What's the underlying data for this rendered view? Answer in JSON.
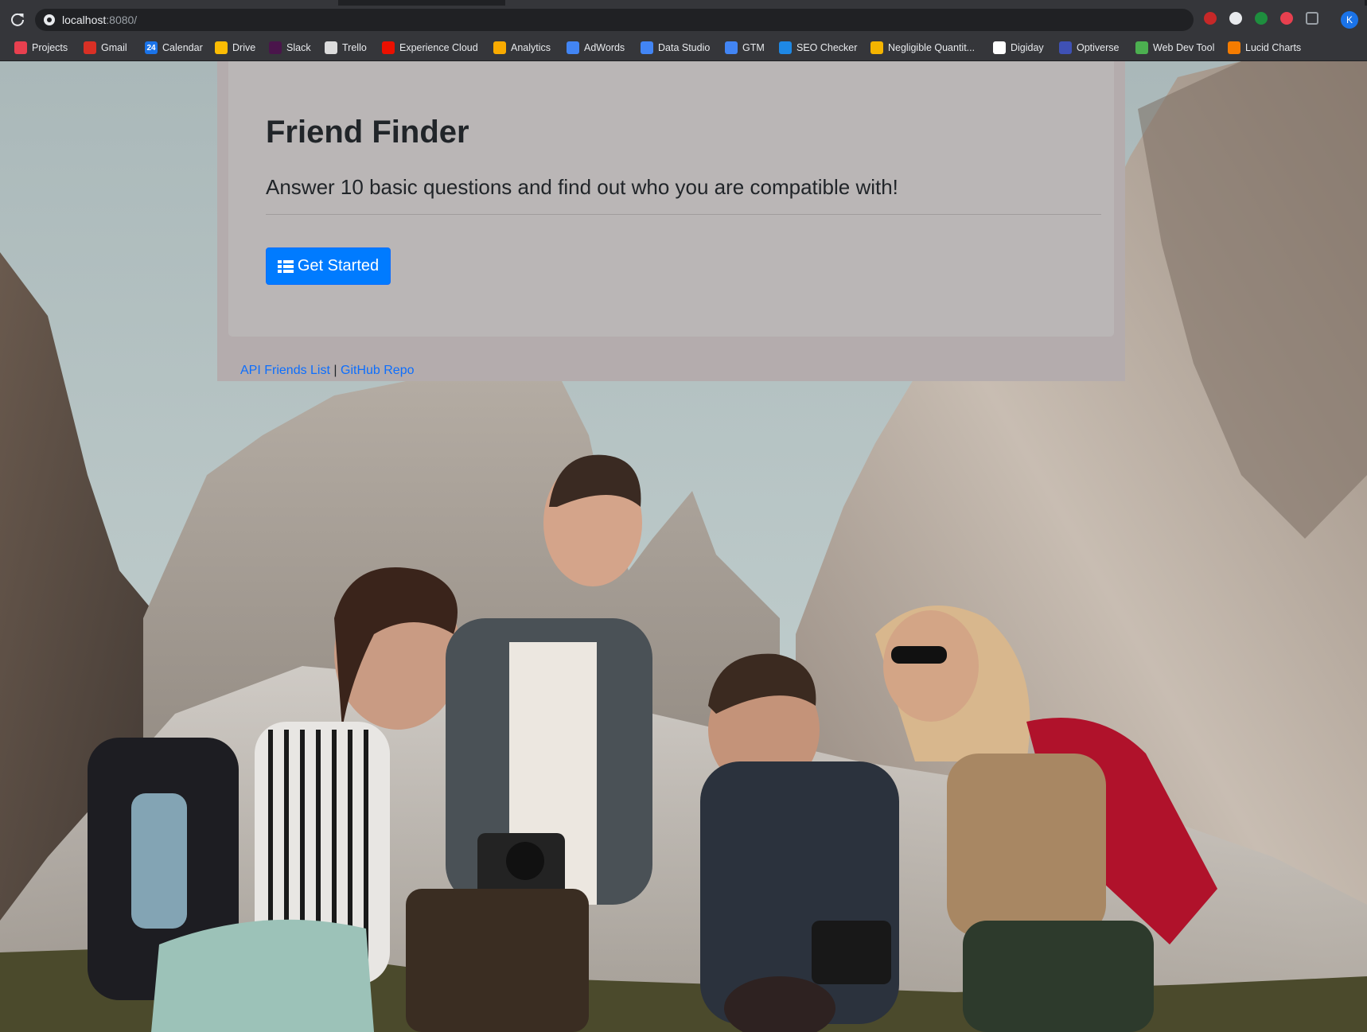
{
  "browser": {
    "url_host": "localhost",
    "url_port": ":8080/",
    "profile_initial": "K",
    "bookmarks": [
      {
        "label": "Projects",
        "icon": "projects-icon",
        "color": "#e8404f"
      },
      {
        "label": "Gmail",
        "icon": "gmail-icon",
        "color": "#d93025"
      },
      {
        "label": "Calendar",
        "icon": "calendar-icon",
        "color": "#1a73e8",
        "glyph": "24"
      },
      {
        "label": "Drive",
        "icon": "drive-icon",
        "color": "#fbbc04"
      },
      {
        "label": "Slack",
        "icon": "slack-icon",
        "color": "#4a154b"
      },
      {
        "label": "Trello",
        "icon": "trello-icon",
        "color": "#dcdcdc"
      },
      {
        "label": "Experience Cloud",
        "icon": "adobe-icon",
        "color": "#eb1000"
      },
      {
        "label": "Analytics",
        "icon": "analytics-icon",
        "color": "#f9ab00"
      },
      {
        "label": "AdWords",
        "icon": "adwords-icon",
        "color": "#4285f4"
      },
      {
        "label": "Data Studio",
        "icon": "data-studio-icon",
        "color": "#4285f4"
      },
      {
        "label": "GTM",
        "icon": "gtm-icon",
        "color": "#4285f4"
      },
      {
        "label": "SEO Checker",
        "icon": "seo-checker-icon",
        "color": "#1e88e5"
      },
      {
        "label": "Negligible Quantit...",
        "icon": "negligible-quantity-icon",
        "color": "#f4b400"
      },
      {
        "label": "Digiday",
        "icon": "digiday-icon",
        "color": "#ffffff"
      },
      {
        "label": "Optiverse",
        "icon": "optiverse-icon",
        "color": "#3f51b5"
      },
      {
        "label": "Web Dev Tool",
        "icon": "web-dev-tool-icon",
        "color": "#4caf50"
      },
      {
        "label": "Lucid Charts",
        "icon": "lucid-charts-icon",
        "color": "#f57c00"
      }
    ]
  },
  "page": {
    "title": "Friend Finder",
    "lead": "Answer 10 basic questions and find out who you are compatible with!",
    "cta_label": "Get Started",
    "footer": {
      "link1": "API Friends List",
      "separator": "|",
      "link2": "GitHub Repo"
    }
  },
  "colors": {
    "primary": "#007bff",
    "panel": "#b4acad",
    "jumbotron": "#bab6b6"
  }
}
